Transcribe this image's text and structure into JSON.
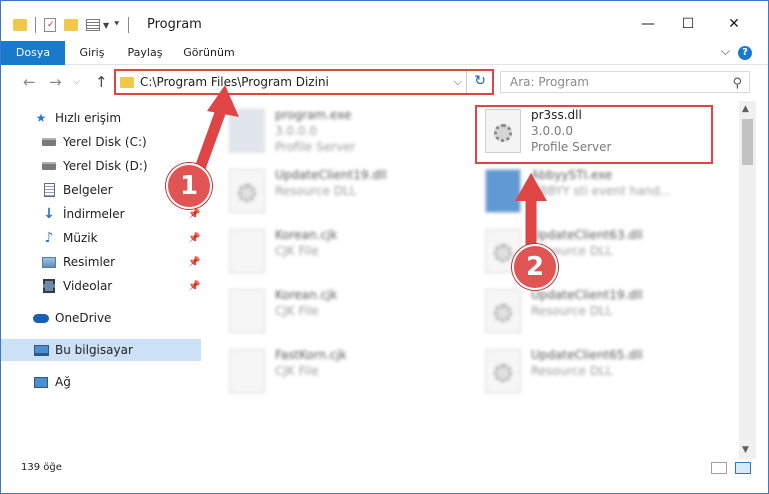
{
  "window": {
    "title": "Program",
    "minimize": "—",
    "maximize": "☐",
    "close": "✕"
  },
  "ribbon": {
    "tabs": [
      "Dosya",
      "Giriş",
      "Paylaş",
      "Görünüm"
    ],
    "active_tab": "Dosya",
    "help": "?"
  },
  "nav": {
    "address": "C:\\Program Files\\Program Dizini",
    "search_placeholder": "Ara: Program"
  },
  "sidebar": {
    "items": [
      {
        "label": "Hızlı erişim",
        "icon": "star-icon",
        "pinned": false,
        "selected": false
      },
      {
        "label": "Yerel Disk (C:)",
        "icon": "drive-icon",
        "pinned": false,
        "selected": false
      },
      {
        "label": "Yerel Disk (D:)",
        "icon": "drive-icon",
        "pinned": false,
        "selected": false
      },
      {
        "label": "Belgeler",
        "icon": "documents-icon",
        "pinned": false,
        "selected": false
      },
      {
        "label": "İndirmeler",
        "icon": "download-icon",
        "pinned": true,
        "selected": false
      },
      {
        "label": "Müzik",
        "icon": "music-icon",
        "pinned": true,
        "selected": false
      },
      {
        "label": "Resimler",
        "icon": "pictures-icon",
        "pinned": true,
        "selected": false
      },
      {
        "label": "Videolar",
        "icon": "video-icon",
        "pinned": true,
        "selected": false
      },
      {
        "label": "OneDrive",
        "icon": "cloud-icon",
        "pinned": false,
        "selected": false
      },
      {
        "label": "Bu bilgisayar",
        "icon": "computer-icon",
        "pinned": false,
        "selected": true
      },
      {
        "label": "Ağ",
        "icon": "network-icon",
        "pinned": false,
        "selected": false
      }
    ]
  },
  "files": [
    {
      "name": "program.exe",
      "line2": "3.0.0.0",
      "line3": "Profile Server",
      "blurred": true
    },
    {
      "name": "pr3ss.dll",
      "line2": "3.0.0.0",
      "line3": "Profile Server",
      "blurred": false
    },
    {
      "name": "UpdateClient19.dll",
      "line2": "Resource DLL",
      "line3": "",
      "blurred": true
    },
    {
      "name": "AbbyySTI.exe",
      "line2": "ABBYY sti event hand...",
      "line3": "",
      "blurred": true
    },
    {
      "name": "Korean.cjk",
      "line2": "CJK File",
      "line3": "",
      "blurred": true
    },
    {
      "name": "UpdateClient63.dll",
      "line2": "Resource DLL",
      "line3": "",
      "blurred": true
    },
    {
      "name": "Korean.cjk",
      "line2": "CJK File",
      "line3": "",
      "blurred": true
    },
    {
      "name": "UpdateClient19.dll",
      "line2": "Resource DLL",
      "line3": "",
      "blurred": true
    },
    {
      "name": "FastKorn.cjk",
      "line2": "CJK File",
      "line3": "",
      "blurred": true
    },
    {
      "name": "UpdateClient65.dll",
      "line2": "Resource DLL",
      "line3": "",
      "blurred": true
    }
  ],
  "status": {
    "item_count": "139 öğe"
  },
  "annotations": {
    "badge1": "1",
    "badge2": "2",
    "color": "#e04545"
  }
}
